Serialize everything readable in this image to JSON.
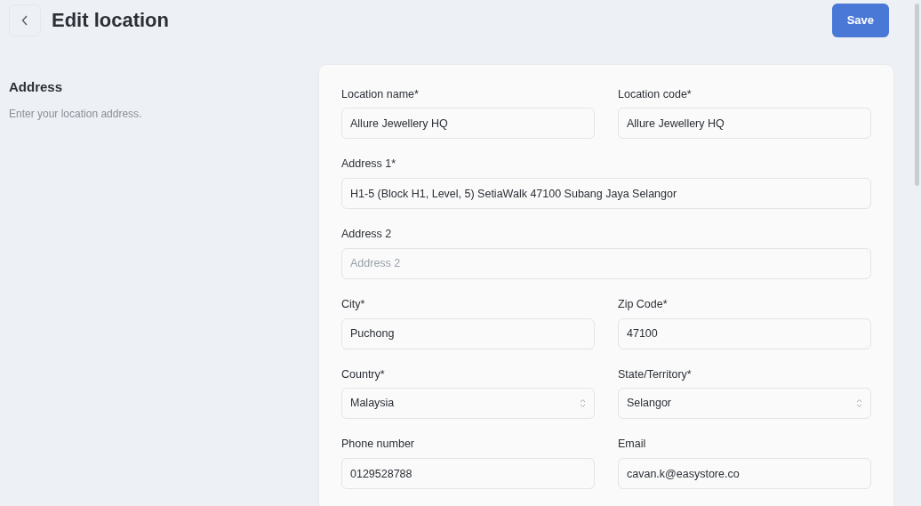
{
  "header": {
    "title": "Edit location",
    "save_button": "Save"
  },
  "section": {
    "title": "Address",
    "description": "Enter your location address."
  },
  "form_rows": [
    [
      {
        "kind": "text",
        "label": "Location name*",
        "value": "Allure Jewellery HQ"
      },
      {
        "kind": "text",
        "label": "Location code*",
        "value": "Allure Jewellery HQ"
      }
    ],
    [
      {
        "kind": "text",
        "label": "Address 1*",
        "value": "H1-5 (Block H1, Level, 5) SetiaWalk 47100 Subang Jaya Selangor"
      }
    ],
    [
      {
        "kind": "text",
        "label": "Address 2",
        "placeholder": "Address 2"
      }
    ],
    [
      {
        "kind": "text",
        "label": "City*",
        "value": "Puchong"
      },
      {
        "kind": "text",
        "label": "Zip Code*",
        "value": "47100"
      }
    ],
    [
      {
        "kind": "select",
        "label": "Country*",
        "value": "Malaysia"
      },
      {
        "kind": "select",
        "label": "State/Territory*",
        "value": "Selangor"
      }
    ],
    [
      {
        "kind": "text",
        "label": "Phone number",
        "value": "0129528788"
      },
      {
        "kind": "text",
        "label": "Email",
        "value": "cavan.k@easystore.co"
      }
    ]
  ]
}
